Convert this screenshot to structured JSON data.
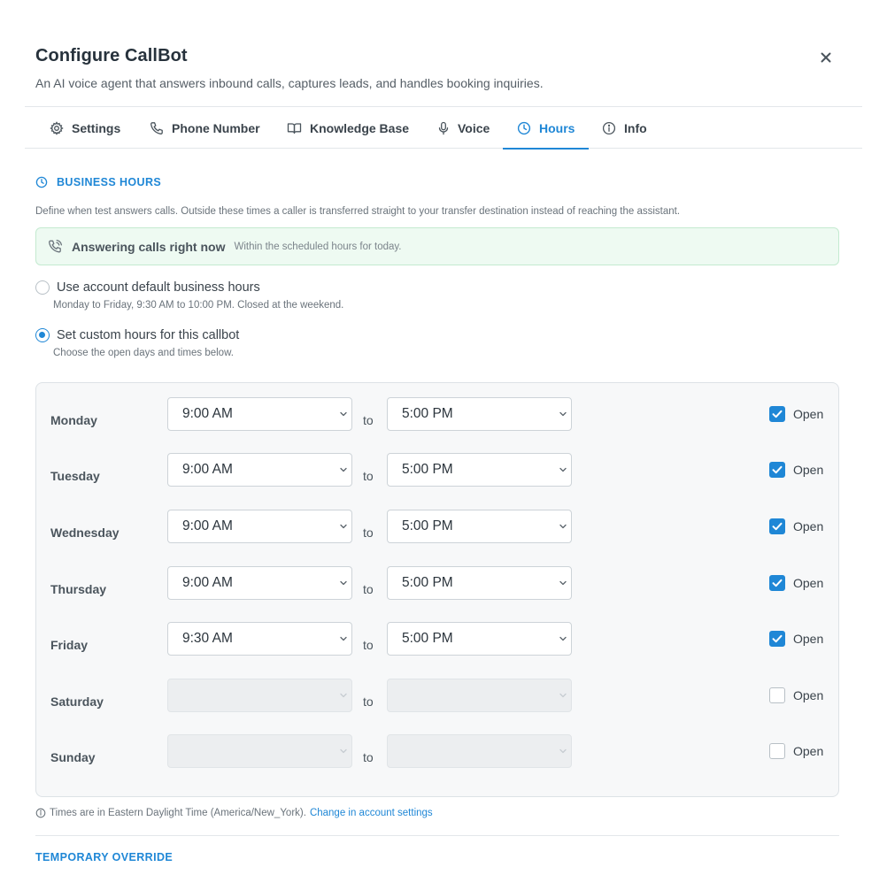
{
  "dialog": {
    "title": "Configure CallBot",
    "subtitle": "An AI voice agent that answers inbound calls, captures leads, and handles booking inquiries."
  },
  "tabs": [
    {
      "label": "Settings",
      "icon": "gear-icon",
      "active": false
    },
    {
      "label": "Phone Number",
      "icon": "phone-icon",
      "active": false
    },
    {
      "label": "Knowledge Base",
      "icon": "book-icon",
      "active": false
    },
    {
      "label": "Voice",
      "icon": "microphone-icon",
      "active": false
    },
    {
      "label": "Hours",
      "icon": "clock-icon",
      "active": true
    },
    {
      "label": "Info",
      "icon": "info-icon",
      "active": false
    }
  ],
  "business_hours": {
    "title": "BUSINESS HOURS",
    "description": "Define when test answers calls. Outside these times a caller is transferred straight to your transfer destination instead of reaching the assistant."
  },
  "status": {
    "title": "Answering calls right now",
    "detail": "Within the scheduled hours for today."
  },
  "options": {
    "default": {
      "label": "Use account default business hours",
      "hint": "Monday to Friday, 9:30 AM to 10:00 PM. Closed at the weekend.",
      "selected": false
    },
    "custom": {
      "label": "Set custom hours for this callbot",
      "hint": "Choose the open days and times below.",
      "selected": true
    }
  },
  "to_label": "to",
  "open_label": "Open",
  "days": [
    {
      "name": "Monday",
      "from": "9:00 AM",
      "to": "5:00 PM",
      "open": true
    },
    {
      "name": "Tuesday",
      "from": "9:00 AM",
      "to": "5:00 PM",
      "open": true
    },
    {
      "name": "Wednesday",
      "from": "9:00 AM",
      "to": "5:00 PM",
      "open": true
    },
    {
      "name": "Thursday",
      "from": "9:00 AM",
      "to": "5:00 PM",
      "open": true
    },
    {
      "name": "Friday",
      "from": "9:30 AM",
      "to": "5:00 PM",
      "open": true
    },
    {
      "name": "Saturday",
      "from": "",
      "to": "",
      "open": false
    },
    {
      "name": "Sunday",
      "from": "",
      "to": "",
      "open": false
    }
  ],
  "timezone": {
    "note": "Times are in Eastern Daylight Time (America/New_York).",
    "link": "Change in account settings"
  },
  "override": {
    "title": "TEMPORARY OVERRIDE"
  },
  "colors": {
    "accent": "#1f87d6",
    "success_bg": "#eefaf2",
    "success_border": "#c4ead0"
  }
}
